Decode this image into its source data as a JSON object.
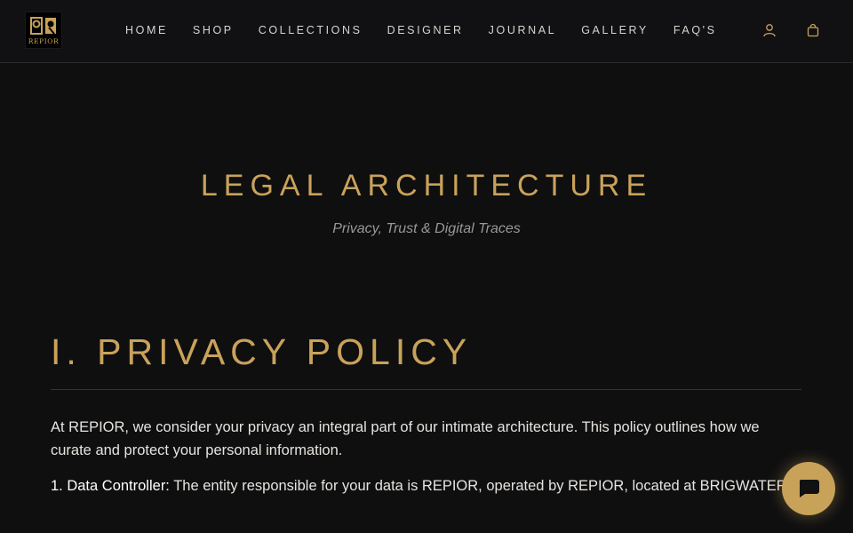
{
  "header": {
    "logo_text": "REPIOR",
    "nav": [
      {
        "label": "HOME"
      },
      {
        "label": "SHOP"
      },
      {
        "label": "COLLECTIONS"
      },
      {
        "label": "DESIGNER"
      },
      {
        "label": "JOURNAL"
      },
      {
        "label": "GALLERY"
      },
      {
        "label": "FAQ'S"
      }
    ],
    "icons": {
      "account": "user-icon",
      "cart": "shopping-bag-icon"
    }
  },
  "hero": {
    "title": "LEGAL ARCHITECTURE",
    "subtitle": "Privacy, Trust & Digital Traces"
  },
  "section": {
    "title": "I. PRIVACY POLICY",
    "intro": "At REPIOR, we consider your privacy an integral part of our intimate architecture. This policy outlines how we curate and protect your personal information.",
    "controller_label": "1. Data Controller:",
    "controller_text": " The entity responsible for your data is REPIOR, operated by REPIOR, located at BRIGWATER."
  },
  "chat": {
    "icon": "chat-bubble-icon"
  },
  "colors": {
    "background": "#0f0f10",
    "accent_gold": "#c9a25a",
    "text": "#e6e3df",
    "muted": "#9a9895"
  }
}
